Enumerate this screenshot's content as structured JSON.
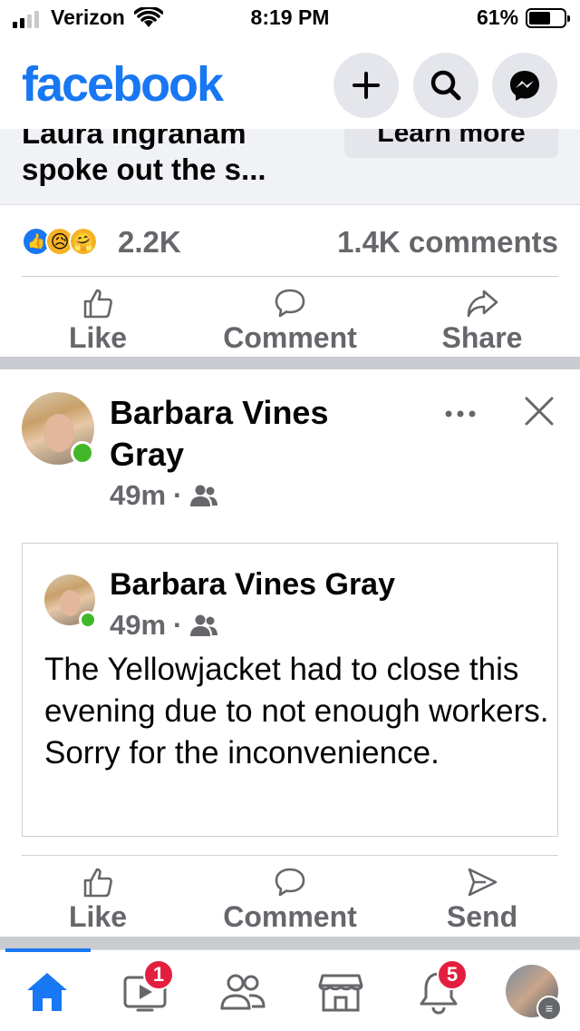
{
  "status_bar": {
    "carrier": "Verizon",
    "time": "8:19 PM",
    "battery_pct": "61%",
    "battery_level": 0.61
  },
  "header": {
    "logo": "facebook",
    "buttons": [
      "plus-icon",
      "search-icon",
      "messenger-icon"
    ]
  },
  "ad": {
    "cut_text": "Laura Ingraham",
    "line": "spoke out the s...",
    "cta": "Learn more"
  },
  "reactions": {
    "count": "2.2K",
    "comments": "1.4K comments",
    "types": [
      "like",
      "sad",
      "care"
    ]
  },
  "actions_top": {
    "like": "Like",
    "comment": "Comment",
    "share": "Share"
  },
  "post": {
    "author_line1": "Barbara Vines",
    "author_line2": "Gray",
    "time": "49m",
    "audience_icon": "friends-icon"
  },
  "shared_post": {
    "author": "Barbara Vines Gray",
    "time": "49m",
    "text": "The Yellowjacket had to close this evening due to not enough workers. Sorry for the inconvenience."
  },
  "actions_bottom": {
    "like": "Like",
    "comment": "Comment",
    "send": "Send"
  },
  "nav": {
    "items": [
      "home-icon",
      "watch-icon",
      "friends-icon",
      "marketplace-icon",
      "notifications-icon",
      "profile-menu"
    ],
    "watch_badge": "1",
    "notifications_badge": "5"
  },
  "colors": {
    "brand": "#1877f2",
    "secondary_text": "#65676b",
    "online": "#42b72a",
    "badge": "#e41e3f"
  }
}
